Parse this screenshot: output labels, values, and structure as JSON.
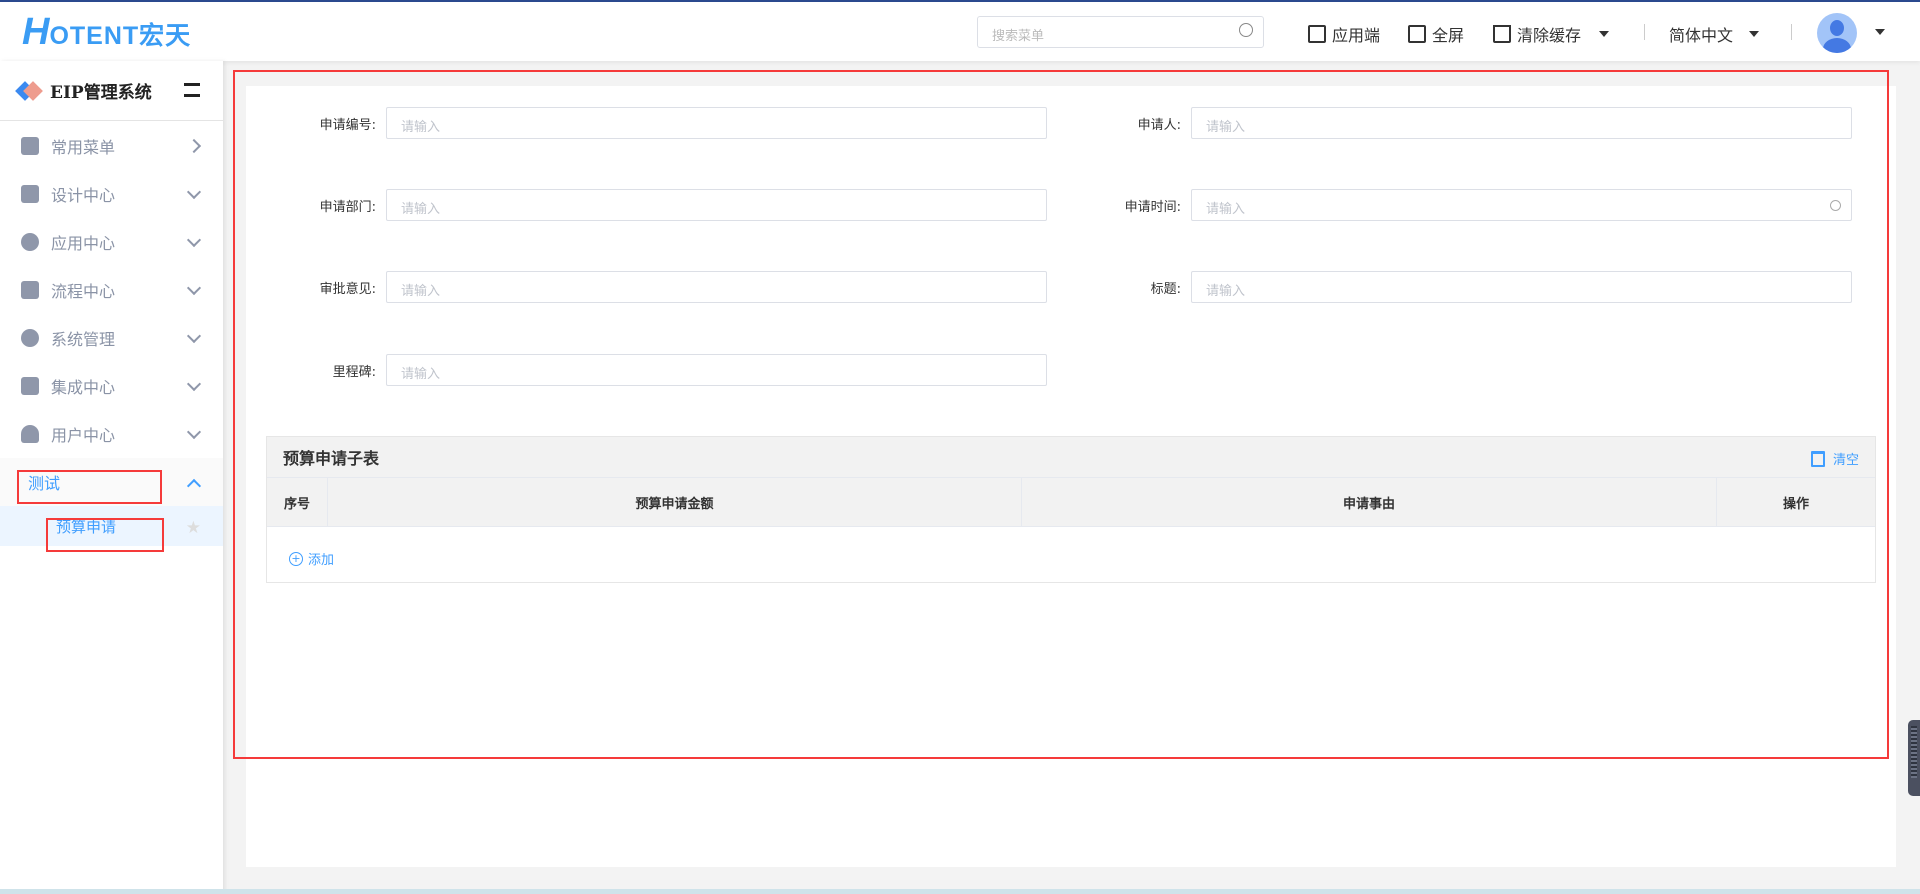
{
  "header": {
    "logo": "HOTENT宏天",
    "logo_h": "H",
    "logo_rest": "OTENT宏天",
    "search_placeholder": "搜索菜单",
    "app_label": "应用端",
    "fullscreen_label": "全屏",
    "clear_cache_label": "清除缓存",
    "language": "简体中文"
  },
  "sidebar": {
    "title": "EIP管理系统",
    "items": [
      {
        "label": "常用菜单"
      },
      {
        "label": "设计中心"
      },
      {
        "label": "应用中心"
      },
      {
        "label": "流程中心"
      },
      {
        "label": "系统管理"
      },
      {
        "label": "集成中心"
      },
      {
        "label": "用户中心"
      },
      {
        "label": "测试"
      }
    ],
    "sub_item": "预算申请"
  },
  "form": {
    "placeholder": "请输入",
    "fields": {
      "apply_no": "申请编号:",
      "applicant": "申请人:",
      "dept": "申请部门:",
      "time": "申请时间:",
      "opinion": "审批意见:",
      "title": "标题:",
      "milestone": "里程碑:"
    }
  },
  "subtable": {
    "title": "预算申请子表",
    "clear_label": "清空",
    "columns": [
      "序号",
      "预算申请金额",
      "申请事由",
      "操作"
    ],
    "add_label": "添加"
  }
}
